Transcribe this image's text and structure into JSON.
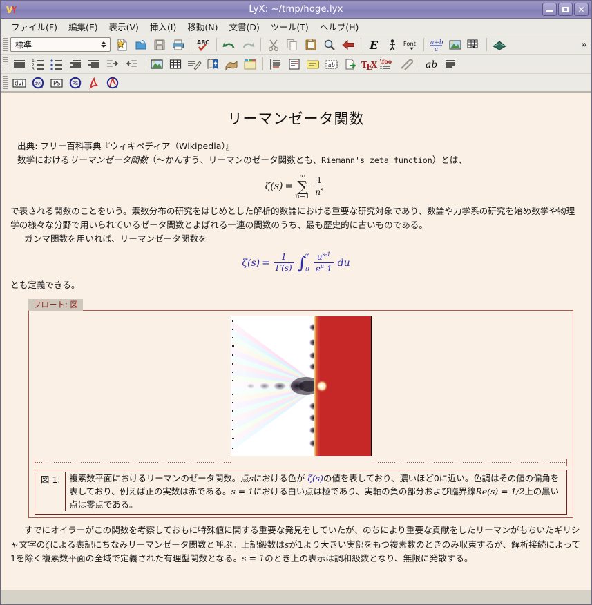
{
  "window": {
    "title": "LyX: ~/tmp/hoge.lyx",
    "app_icon": "lyx-logo-icon",
    "buttons": {
      "minimize": "minimize-icon",
      "maximize": "maximize-icon",
      "close": "close-icon"
    }
  },
  "menubar": {
    "items": [
      {
        "label": "ファイル(F)",
        "mnemonic": "F"
      },
      {
        "label": "編集(E)",
        "mnemonic": "E"
      },
      {
        "label": "表示(V)",
        "mnemonic": "V"
      },
      {
        "label": "挿入(I)",
        "mnemonic": "I"
      },
      {
        "label": "移動(N)",
        "mnemonic": "N"
      },
      {
        "label": "文書(D)",
        "mnemonic": "D"
      },
      {
        "label": "ツール(T)",
        "mnemonic": "T"
      },
      {
        "label": "ヘルプ(H)",
        "mnemonic": "H"
      }
    ]
  },
  "toolbar1": {
    "layout_combo_value": "標準",
    "overflow_label": "»",
    "buttons": [
      "new-document-icon",
      "open-document-icon",
      "save-document-icon",
      "print-icon",
      "spellcheck-icon",
      "undo-icon",
      "redo-icon",
      "cut-icon",
      "copy-icon",
      "paste-icon",
      "find-replace-icon",
      "navigate-back-icon",
      "emphasis-icon",
      "noun-style-icon",
      "font-style-icon",
      "math-inline-icon",
      "insert-graphics-icon",
      "insert-table-icon",
      "thesaurus-icon"
    ]
  },
  "toolbar2": {
    "buttons": [
      "paragraph-align-icon",
      "numbered-list-icon",
      "bullet-list-icon",
      "decrease-depth-icon",
      "increase-depth-icon",
      "indent-right-icon",
      "indent-left-icon",
      "insert-figure-float-icon",
      "insert-table-float-icon",
      "insert-footnote-icon",
      "insert-marginal-note-icon",
      "insert-branch-icon",
      "insert-file-icon",
      "insert-box-icon",
      "insert-label-icon",
      "insert-citation-icon",
      "insert-index-icon",
      "insert-note-icon",
      "insert-url-icon",
      "insert-tex-code-icon",
      "insert-nomenclature-icon",
      "insert-attachment-icon",
      "text-style-icon",
      "paragraph-settings-icon"
    ]
  },
  "toolbar3": {
    "buttons": [
      {
        "name": "view-dvi-icon",
        "label": "dvi"
      },
      {
        "name": "update-dvi-icon",
        "label": "dvi"
      },
      {
        "name": "view-ps-icon",
        "label": "PS"
      },
      {
        "name": "update-ps-icon",
        "label": "PS"
      },
      {
        "name": "view-pdf-icon",
        "label": "PDF"
      },
      {
        "name": "update-pdf-icon",
        "label": "PDF"
      }
    ]
  },
  "document": {
    "title": "リーマンゼータ関数",
    "source_line": "出典: フリー百科事典『ウィキペディア（Wikipedia）』",
    "intro_line_a": "数学における",
    "intro_line_a_italic": "リーマンゼータ関数",
    "intro_line_a_tail": "（〜かんすう、リーマンのゼータ関数とも、",
    "intro_line_a_mono": "Riemann's zeta function",
    "intro_line_a_end": "）とは、",
    "equation1": {
      "lhs": "ζ(s)",
      "eq": "=",
      "operator": "∑",
      "sum_upper": "∞",
      "sum_lower": "n=1",
      "frac_num": "1",
      "frac_den": "n",
      "frac_den_sup": "s",
      "latex": "\\zeta(s) = \\sum_{n=1}^{\\infty} \\frac{1}{n^s}",
      "color": "#1a1a1a"
    },
    "para2_a": "で表される関数のことをいう。素数分布の研究をはじめとした解析的数論における重要な研究対象であり、数論や力学系の研究を始め数学や物理学の様々な分野で用いられているゼータ関数とよばれる一連の関数のうち、最も歴史的に古いものである。",
    "para2_b": "ガンマ関数を用いれば、リーマンゼータ関数を",
    "equation2": {
      "lhs": "ζ(s)",
      "eq": "=",
      "frac1_num": "1",
      "frac1_den": "Γ(s)",
      "int_sign": "∫",
      "int_upper": "∞",
      "int_lower": "0",
      "frac2_num": "u",
      "frac2_num_sup": "s-1",
      "frac2_den": "e",
      "frac2_den_sup": "u",
      "frac2_den_tail": "-1",
      "differential": "du",
      "latex": "\\zeta(s) = \\frac{1}{\\Gamma(s)}\\int_0^{\\infty}\\frac{u^{s-1}}{e^u-1}du",
      "color": "#2c2cae"
    },
    "para3": "とも定義できる。",
    "float": {
      "label_prefix": "フロート: ",
      "label_type": "図",
      "figure_alt": "riemann-zeta-domain-coloring",
      "caption_number": "図 1:",
      "caption_seg1": "複素数平面におけるリーマンのゼータ関数。点",
      "caption_math1": "s",
      "caption_seg2": "における色が ",
      "caption_math2": "ζ(s)",
      "caption_seg3": "の値を表しており、濃いほど0に近い。色調はその値の偏角を表しており、例えば正の実数は赤である。",
      "caption_math3": "s = 1",
      "caption_seg4": "における白い点は極であり、実軸の負の部分および臨界線",
      "caption_math4": "Re(s) = 1/2",
      "caption_seg5": "上の黒い点は零点である。"
    },
    "para4_a": "すでにオイラーがこの関数を考察しておもに特殊値に関する重要な発見をしていたが、のちにより重要な貢献をしたリーマンがもちいたギリシャ文字の",
    "para4_math1": "ζ",
    "para4_b": "による表記にちなみリーマンゼータ関数と呼ぶ。上記級数は",
    "para4_math2": "s",
    "para4_c": "が1より大きい実部をもつ複素数のときのみ収束するが、解析接続によって1を除く複素数平面の全域で定義された有理型関数となる。",
    "para4_math3": "s = 1",
    "para4_d": "のとき上の表示は調和級数となり、無限に発散する。"
  },
  "colors": {
    "titlebar": "#8e89bd",
    "canvas_bg": "#faf0e6",
    "float_border": "#b0564e",
    "caption_border": "#7a1f18",
    "float_label_text": "#8c2a21",
    "math_blue": "#2c2cae",
    "toolbar_bg": "#eceae4"
  }
}
